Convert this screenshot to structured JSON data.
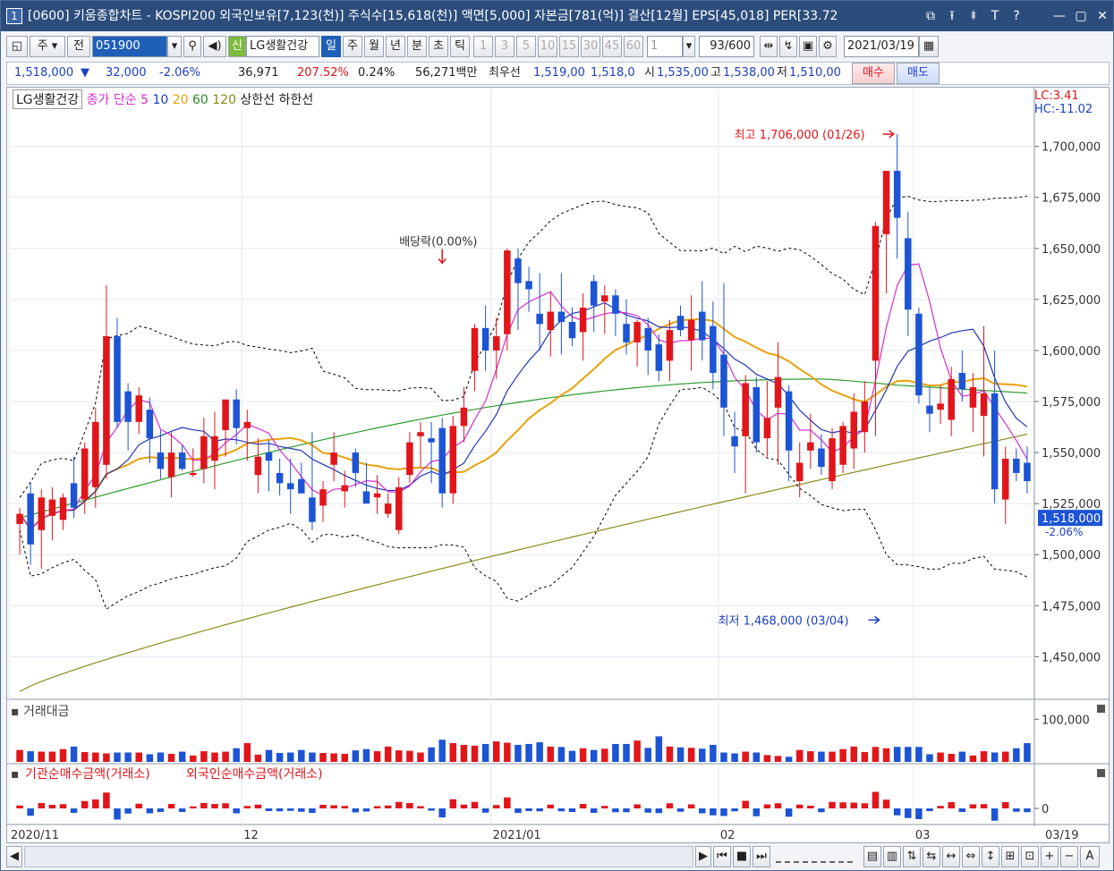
{
  "window": {
    "badge": "1",
    "title": "[0600] 키움종합차트 - KOSPI200 외국인보유[7,123(천)] 주식수[15,618(천)] 액면[5,000] 자본금[781(억)] 결산[12월] EPS[45,018] PER[33.72",
    "buttons": [
      "⧉",
      "⭱",
      "⯒",
      "T",
      "?",
      "—",
      "▢",
      "✕"
    ]
  },
  "toolbar": {
    "market_type": "주",
    "period_prefix": "전",
    "code": "051900",
    "new_badge": "신",
    "stock_name": "LG생활건강",
    "periods": [
      "일",
      "주",
      "월",
      "년",
      "분",
      "초",
      "틱"
    ],
    "active_period": "일",
    "intervals": [
      "1",
      "3",
      "5",
      "10",
      "15",
      "30",
      "45",
      "60"
    ],
    "interval_value": "1",
    "count": "93/600",
    "date": "2021/03/19"
  },
  "quote": {
    "price": "1,518,000",
    "change": "32,000",
    "change_pct": "-2.06%",
    "volume": "36,971",
    "vol_ratio": "207.52%",
    "turnover": "0.24%",
    "amount": "56,271백만",
    "best_label": "최우선",
    "best_sell": "1,519,00",
    "best_buy": "1,518,0",
    "open_label": "시",
    "open": "1,535,00",
    "high_label": "고",
    "high": "1,538,00",
    "low_label": "저",
    "low": "1,510,00",
    "buy_button": "매수",
    "sell_button": "매도"
  },
  "legend": {
    "name": "LG생활건강",
    "price_label": "종가 단순",
    "ma": [
      "5",
      "10",
      "20",
      "60",
      "120"
    ],
    "upper": "상한선",
    "lower": "하한선"
  },
  "indicators": {
    "lc": "LC:3.41",
    "hc": "HC:-11.02"
  },
  "annotations": {
    "high": "최고 1,706,000 (01/26)",
    "low": "최저 1,468,000 (03/04)",
    "dividend": "배당락(0.00%)"
  },
  "current_tag": {
    "price": "1,518,000",
    "pct": "-2.06%"
  },
  "volume_panel": {
    "title": "거래대금",
    "tick": "100,000"
  },
  "flow_panel": {
    "title_a": "기관순매수금액(거래소)",
    "title_b": "외국인순매수금액(거래소)",
    "tick": "0"
  },
  "x_axis": [
    "2020/11",
    "12",
    "2021/01",
    "02",
    "03"
  ],
  "x_axis_last": "03/19",
  "colors": {
    "up": "#e0161b",
    "down": "#1c54d4",
    "ma5": "#d42ed0",
    "ma10": "#2236b8",
    "ma20": "#e8a20a",
    "ma60": "#2e9a2e",
    "ma120": "#8a8a1c",
    "band": "#000000"
  },
  "chart_data": {
    "type": "candlestick",
    "y_range": [
      1430000,
      1720000
    ],
    "y_ticks": [
      "1,700,000",
      "1,675,000",
      "1,650,000",
      "1,625,000",
      "1,600,000",
      "1,575,000",
      "1,550,000",
      "1,525,000",
      "1,500,000",
      "1,475,000",
      "1,450,000"
    ],
    "ohlc": [
      [
        1515000,
        1523000,
        1500000,
        1520000
      ],
      [
        1530000,
        1535000,
        1495000,
        1505000
      ],
      [
        1512000,
        1532000,
        1493000,
        1528000
      ],
      [
        1519000,
        1533000,
        1507000,
        1527000
      ],
      [
        1517000,
        1530000,
        1512000,
        1528000
      ],
      [
        1535000,
        1548000,
        1518000,
        1523000
      ],
      [
        1527000,
        1555000,
        1520000,
        1552000
      ],
      [
        1533000,
        1572000,
        1523000,
        1565000
      ],
      [
        1544000,
        1632000,
        1537000,
        1607000
      ],
      [
        1607000,
        1616000,
        1562000,
        1565000
      ],
      [
        1580000,
        1584000,
        1551000,
        1565000
      ],
      [
        1565000,
        1582000,
        1559000,
        1578000
      ],
      [
        1571000,
        1577000,
        1545000,
        1557000
      ],
      [
        1550000,
        1561000,
        1537000,
        1542000
      ],
      [
        1538000,
        1560000,
        1528000,
        1550000
      ],
      [
        1550000,
        1554000,
        1541000,
        1542000
      ],
      [
        1539000,
        1552000,
        1538000,
        1540000
      ],
      [
        1542000,
        1567000,
        1535000,
        1558000
      ],
      [
        1546000,
        1570000,
        1532000,
        1558000
      ],
      [
        1561000,
        1576000,
        1548000,
        1576000
      ],
      [
        1576000,
        1581000,
        1554000,
        1562000
      ],
      [
        1562000,
        1571000,
        1546000,
        1565000
      ],
      [
        1539000,
        1557000,
        1530000,
        1548000
      ],
      [
        1550000,
        1556000,
        1531000,
        1546000
      ],
      [
        1540000,
        1547000,
        1529000,
        1535000
      ],
      [
        1535000,
        1547000,
        1520000,
        1532000
      ],
      [
        1537000,
        1545000,
        1530000,
        1530000
      ],
      [
        1528000,
        1560000,
        1512000,
        1516000
      ],
      [
        1524000,
        1536000,
        1516000,
        1532000
      ],
      [
        1544000,
        1560000,
        1536000,
        1550000
      ],
      [
        1531000,
        1541000,
        1523000,
        1534000
      ],
      [
        1550000,
        1552000,
        1533000,
        1540000
      ],
      [
        1531000,
        1545000,
        1525000,
        1525000
      ],
      [
        1528000,
        1539000,
        1520000,
        1530000
      ],
      [
        1520000,
        1530000,
        1518000,
        1525000
      ],
      [
        1512000,
        1538000,
        1510000,
        1533000
      ],
      [
        1539000,
        1560000,
        1535000,
        1555000
      ],
      [
        1558000,
        1565000,
        1543000,
        1560000
      ],
      [
        1557000,
        1565000,
        1535000,
        1555000
      ],
      [
        1562000,
        1567000,
        1523000,
        1530000
      ],
      [
        1530000,
        1568000,
        1525000,
        1563000
      ],
      [
        1563000,
        1582000,
        1555000,
        1572000
      ],
      [
        1590000,
        1613000,
        1580000,
        1611000
      ],
      [
        1611000,
        1622000,
        1590000,
        1600000
      ],
      [
        1600000,
        1616000,
        1586000,
        1607000
      ],
      [
        1608000,
        1650000,
        1600000,
        1649000
      ],
      [
        1645000,
        1650000,
        1610000,
        1633000
      ],
      [
        1634000,
        1641000,
        1619000,
        1630000
      ],
      [
        1618000,
        1638000,
        1600000,
        1613000
      ],
      [
        1610000,
        1629000,
        1597000,
        1619000
      ],
      [
        1619000,
        1638000,
        1598000,
        1614000
      ],
      [
        1614000,
        1621000,
        1602000,
        1606000
      ],
      [
        1609000,
        1628000,
        1595000,
        1621000
      ],
      [
        1634000,
        1637000,
        1609000,
        1622000
      ],
      [
        1624000,
        1632000,
        1608000,
        1627000
      ],
      [
        1627000,
        1630000,
        1607000,
        1618000
      ],
      [
        1613000,
        1625000,
        1598000,
        1604000
      ],
      [
        1604000,
        1615000,
        1592000,
        1614000
      ],
      [
        1611000,
        1616000,
        1588000,
        1600000
      ],
      [
        1603000,
        1608000,
        1585000,
        1590000
      ],
      [
        1595000,
        1615000,
        1585000,
        1610000
      ],
      [
        1617000,
        1622000,
        1607000,
        1610000
      ],
      [
        1605000,
        1627000,
        1590000,
        1615000
      ],
      [
        1619000,
        1634000,
        1595000,
        1605000
      ],
      [
        1612000,
        1624000,
        1581000,
        1589000
      ],
      [
        1598000,
        1633000,
        1558000,
        1572000
      ],
      [
        1558000,
        1570000,
        1540000,
        1553000
      ],
      [
        1558000,
        1588000,
        1530000,
        1584000
      ],
      [
        1582000,
        1587000,
        1550000,
        1555000
      ],
      [
        1557000,
        1585000,
        1548000,
        1567000
      ],
      [
        1572000,
        1604000,
        1544000,
        1587000
      ],
      [
        1580000,
        1583000,
        1536000,
        1551000
      ],
      [
        1536000,
        1555000,
        1528000,
        1545000
      ],
      [
        1551000,
        1569000,
        1542000,
        1555000
      ],
      [
        1552000,
        1559000,
        1539000,
        1543000
      ],
      [
        1536000,
        1562000,
        1532000,
        1557000
      ],
      [
        1544000,
        1565000,
        1540000,
        1563000
      ],
      [
        1552000,
        1579000,
        1542000,
        1570000
      ],
      [
        1560000,
        1585000,
        1550000,
        1575000
      ],
      [
        1595000,
        1663000,
        1558000,
        1661000
      ],
      [
        1657000,
        1683000,
        1628000,
        1688000
      ],
      [
        1688000,
        1706000,
        1645000,
        1665000
      ],
      [
        1655000,
        1668000,
        1607000,
        1620000
      ],
      [
        1618000,
        1621000,
        1574000,
        1578000
      ],
      [
        1573000,
        1582000,
        1560000,
        1569000
      ],
      [
        1571000,
        1583000,
        1564000,
        1574000
      ],
      [
        1566000,
        1592000,
        1558000,
        1586000
      ],
      [
        1589000,
        1600000,
        1575000,
        1581000
      ],
      [
        1572000,
        1589000,
        1560000,
        1582000
      ],
      [
        1568000,
        1612000,
        1548000,
        1579000
      ],
      [
        1579000,
        1600000,
        1525000,
        1532000
      ],
      [
        1527000,
        1553000,
        1515000,
        1547000
      ],
      [
        1547000,
        1552000,
        1536000,
        1540000
      ],
      [
        1545000,
        1553000,
        1530000,
        1536000
      ]
    ],
    "volume": [
      28,
      25,
      24,
      24,
      30,
      36,
      23,
      22,
      20,
      22,
      22,
      22,
      18,
      22,
      19,
      24,
      15,
      25,
      22,
      24,
      32,
      44,
      17,
      28,
      21,
      22,
      28,
      22,
      21,
      20,
      19,
      27,
      30,
      25,
      36,
      27,
      26,
      22,
      34,
      52,
      44,
      40,
      38,
      42,
      48,
      45,
      40,
      42,
      46,
      36,
      35,
      26,
      32,
      28,
      31,
      42,
      42,
      50,
      33,
      60,
      36,
      34,
      33,
      31,
      40,
      22,
      20,
      24,
      22,
      16,
      14,
      12
    ],
    "volume_colors": "mixed"
  },
  "bottom": {
    "buttons": [
      "◀",
      "▶",
      "⏮",
      "■",
      "⏭",
      "+",
      "−",
      "A"
    ]
  }
}
